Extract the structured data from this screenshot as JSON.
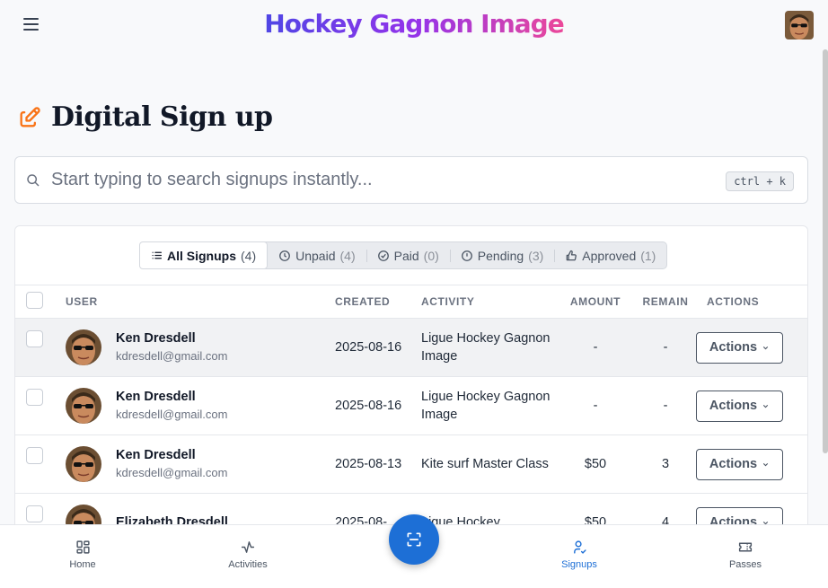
{
  "brand": {
    "title": "Hockey Gagnon Image"
  },
  "page": {
    "title": "Digital Sign up"
  },
  "search": {
    "placeholder": "Start typing to search signups instantly...",
    "shortcut": "ctrl + k"
  },
  "tabs": [
    {
      "label": "All Signups",
      "count": "(4)",
      "icon": "list-icon",
      "active": true
    },
    {
      "label": "Unpaid",
      "count": "(4)",
      "icon": "clock-icon"
    },
    {
      "label": "Paid",
      "count": "(0)",
      "icon": "check-circle-icon"
    },
    {
      "label": "Pending",
      "count": "(3)",
      "icon": "alert-circle-icon"
    },
    {
      "label": "Approved",
      "count": "(1)",
      "icon": "thumbs-up-icon"
    }
  ],
  "table": {
    "headers": {
      "user": "USER",
      "created": "CREATED",
      "activity": "ACTIVITY",
      "amount": "AMOUNT",
      "remain": "REMAIN",
      "actions": "ACTIONS"
    },
    "rows": [
      {
        "name": "Ken Dresdell",
        "email": "kdresdell@gmail.com",
        "created": "2025-08-16",
        "activity": "Ligue Hockey Gagnon Image",
        "amount": "-",
        "remain": "-",
        "action": "Actions"
      },
      {
        "name": "Ken Dresdell",
        "email": "kdresdell@gmail.com",
        "created": "2025-08-16",
        "activity": "Ligue Hockey Gagnon Image",
        "amount": "-",
        "remain": "-",
        "action": "Actions"
      },
      {
        "name": "Ken Dresdell",
        "email": "kdresdell@gmail.com",
        "created": "2025-08-13",
        "activity": "Kite surf Master Class",
        "amount": "$50",
        "remain": "3",
        "action": "Actions"
      },
      {
        "name": "Elizabeth Dresdell",
        "email": "",
        "created": "2025-08-",
        "activity": "Ligue Hockey",
        "amount": "$50",
        "remain": "4",
        "action": "Actions"
      }
    ]
  },
  "nav": {
    "home": "Home",
    "activities": "Activities",
    "signups": "Signups",
    "passes": "Passes"
  },
  "colors": {
    "accent": "#1d6fd6",
    "title_icon": "#f97316"
  }
}
